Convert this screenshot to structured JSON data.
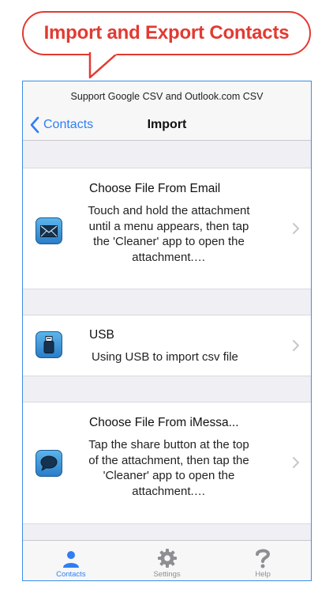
{
  "banner": {
    "title": "Import and Export Contacts"
  },
  "status": {
    "text": "Support Google CSV and Outlook.com CSV"
  },
  "navbar": {
    "back_label": "Contacts",
    "title": "Import"
  },
  "options": [
    {
      "title": "Choose File From Email",
      "description": "Touch and hold the attachment until a menu appears, then tap the 'Cleaner' app to open the attachment.…",
      "icon": "mail-icon"
    },
    {
      "title": "USB",
      "description": "Using USB to import csv file",
      "icon": "usb-icon"
    },
    {
      "title": "Choose File From iMessa...",
      "description": "Tap the share button at the top of the attachment, then tap the 'Cleaner' app to open the attachment.…",
      "icon": "message-bubble-icon"
    }
  ],
  "tabs": [
    {
      "label": "Contacts",
      "icon": "person-icon",
      "active": true
    },
    {
      "label": "Settings",
      "icon": "gear-icon",
      "active": false
    },
    {
      "label": "Help",
      "icon": "question-mark-icon",
      "active": false
    }
  ],
  "colors": {
    "accent": "#2f7ef4",
    "banner_red": "#e23a32",
    "frame": "#3d8ee8"
  }
}
